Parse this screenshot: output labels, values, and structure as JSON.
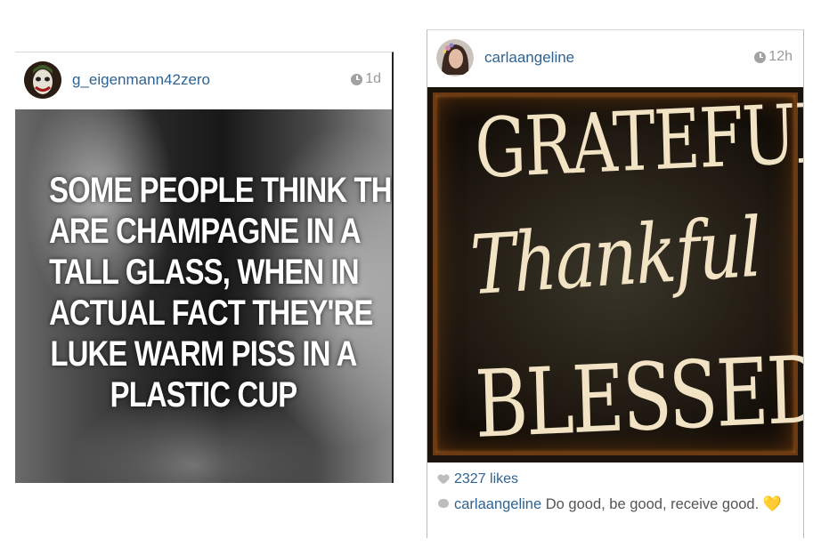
{
  "posts": [
    {
      "username": "g_eigenmann42zero",
      "time": "1d",
      "quote_lines": [
        "SOME PEOPLE THINK THEY",
        "ARE CHAMPAGNE IN A",
        "TALL GLASS, WHEN IN",
        "ACTUAL FACT THEY'RE",
        "LUKE WARM PISS IN A",
        "PLASTIC CUP"
      ]
    },
    {
      "username": "carlaangeline",
      "time": "12h",
      "sign_words": [
        "GRATEFUL",
        "Thankful",
        "BLESSED"
      ],
      "likes": "2327 likes",
      "caption_user": "carlaangeline",
      "caption_text": "Do good, be good, receive good.",
      "caption_emoji": "💛"
    }
  ],
  "colors": {
    "username": "#2f6391",
    "time": "#9a9a9a",
    "sign_text": "#f1e3c4"
  },
  "icons": [
    "clock-icon",
    "heart-icon",
    "comment-icon"
  ]
}
